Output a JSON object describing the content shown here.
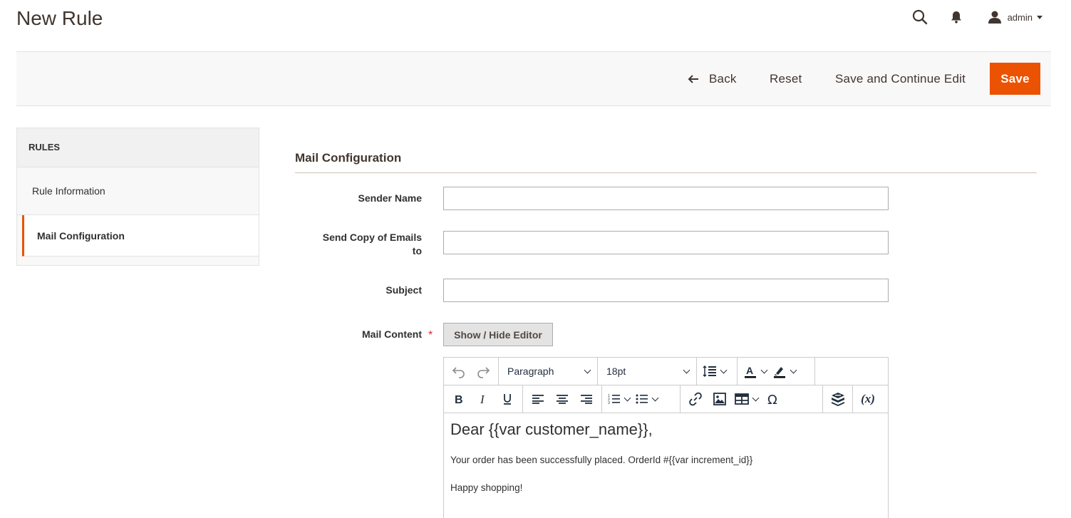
{
  "page": {
    "title": "New Rule"
  },
  "header": {
    "user_name": "admin"
  },
  "actions": {
    "back_label": "Back",
    "reset_label": "Reset",
    "save_continue_label": "Save and Continue Edit",
    "save_label": "Save"
  },
  "sidebar": {
    "title": "RULES",
    "items": [
      {
        "label": "Rule Information",
        "active": false
      },
      {
        "label": "Mail Configuration",
        "active": true
      }
    ]
  },
  "section": {
    "title": "Mail Configuration"
  },
  "form": {
    "sender_name": {
      "label": "Sender Name",
      "value": ""
    },
    "send_copy": {
      "label_line1": "Send Copy of Emails",
      "label_line2": "to",
      "value": ""
    },
    "subject": {
      "label": "Subject",
      "value": ""
    },
    "mail_content": {
      "label": "Mail Content",
      "required_mark": "*",
      "toggle_label": "Show / Hide Editor"
    }
  },
  "editor": {
    "block_format": "Paragraph",
    "font_size": "18pt",
    "variable_button": "(x)",
    "content": {
      "heading": "Dear {{var customer_name}},",
      "paragraph1": "Your order has been successfully placed. OrderId #{{var increment_id}}",
      "paragraph2": "Happy shopping!"
    }
  },
  "colors": {
    "accent": "#eb5202",
    "required": "#e22626"
  },
  "icons": [
    "search-icon",
    "bell-icon",
    "user-icon",
    "back-arrow-icon",
    "undo-icon",
    "redo-icon",
    "line-height-icon",
    "text-color-icon",
    "highlight-icon",
    "bold-icon",
    "italic-icon",
    "underline-icon",
    "align-left-icon",
    "align-center-icon",
    "align-right-icon",
    "numbered-list-icon",
    "bullet-list-icon",
    "link-icon",
    "image-icon",
    "table-icon",
    "omega-icon",
    "widget-icon"
  ]
}
